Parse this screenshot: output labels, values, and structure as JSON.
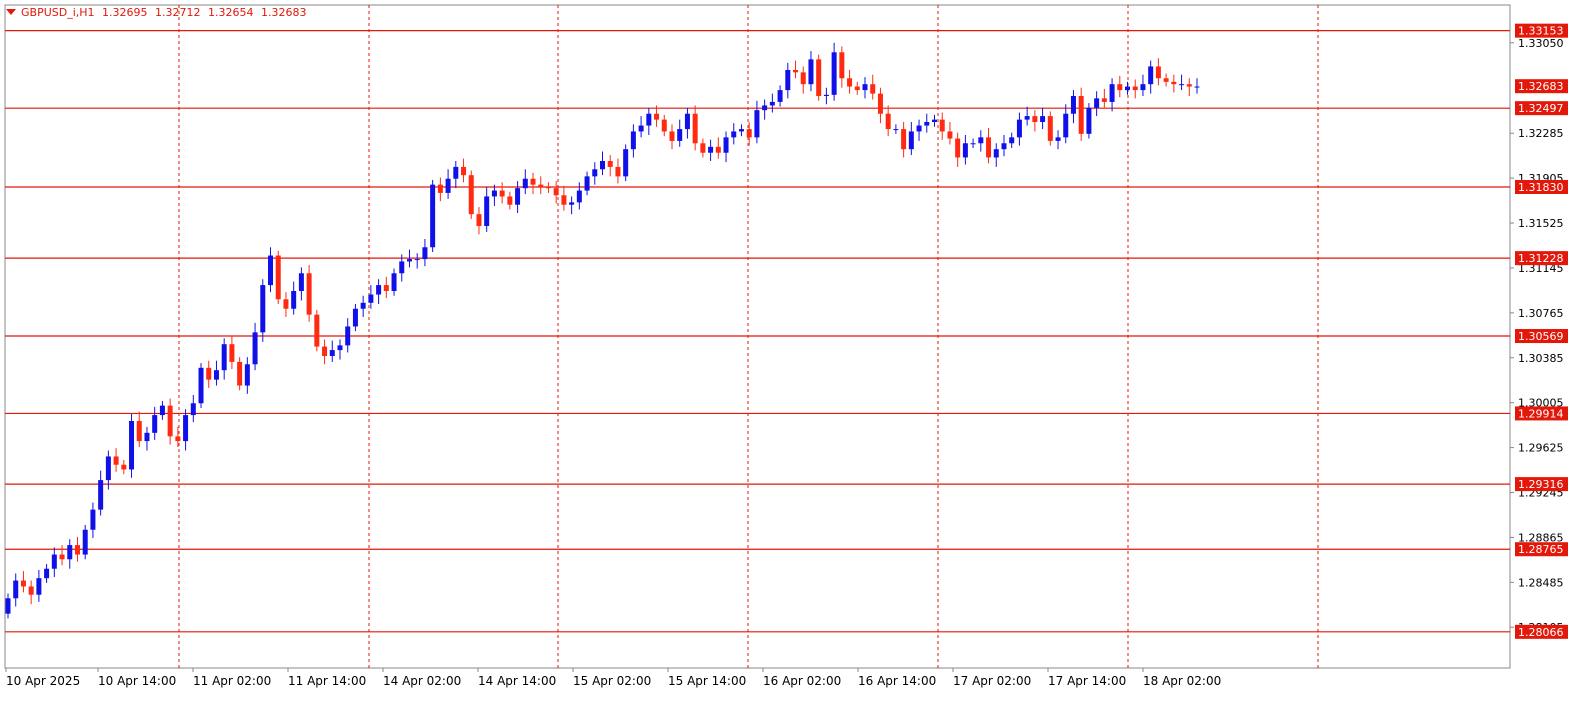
{
  "header": {
    "symbol": "GBPUSD_i,H1",
    "open": "1.32695",
    "high": "1.32712",
    "low": "1.32654",
    "close": "1.32683"
  },
  "colors": {
    "bull": "#1010e8",
    "bear": "#ff2a10",
    "level_line": "#e3170a",
    "label_bg": "#e3170a",
    "grid": "#e3170a",
    "axis_text": "#e3170a"
  },
  "chart_data": {
    "type": "candlestick",
    "symbol": "GBPUSD_i",
    "timeframe": "H1",
    "ylim": [
      1.2776,
      1.3337
    ],
    "y_ticks": [
      "1.33050",
      "1.32285",
      "1.31905",
      "1.31525",
      "1.31145",
      "1.30765",
      "1.30385",
      "1.30005",
      "1.29625",
      "1.29245",
      "1.28865",
      "1.28485",
      "1.28105"
    ],
    "x_labels": [
      "10 Apr 2025",
      "10 Apr 14:00",
      "11 Apr 02:00",
      "11 Apr 14:00",
      "14 Apr 02:00",
      "14 Apr 14:00",
      "15 Apr 02:00",
      "15 Apr 14:00",
      "16 Apr 02:00",
      "16 Apr 14:00",
      "17 Apr 02:00",
      "17 Apr 14:00",
      "18 Apr 02:00"
    ],
    "horizontal_levels": [
      "1.33153",
      "1.32497",
      "1.31830",
      "1.31228",
      "1.30569",
      "1.29914",
      "1.29316",
      "1.28765",
      "1.28066"
    ],
    "current_price": "1.32683",
    "grid": "vertical dashed",
    "closes": [
      1.2835,
      1.285,
      1.2845,
      1.2838,
      1.2852,
      1.286,
      1.2872,
      1.2868,
      1.288,
      1.2872,
      1.2893,
      1.291,
      1.2935,
      1.2955,
      1.2948,
      1.2944,
      1.2985,
      1.2968,
      1.2975,
      1.299,
      1.2998,
      1.2972,
      1.2968,
      1.299,
      1.3,
      1.303,
      1.302,
      1.3028,
      1.305,
      1.3035,
      1.3015,
      1.3033,
      1.306,
      1.31,
      1.3125,
      1.3088,
      1.308,
      1.3095,
      1.311,
      1.3075,
      1.3048,
      1.304,
      1.3045,
      1.3049,
      1.3065,
      1.308,
      1.3085,
      1.3092,
      1.31,
      1.3095,
      1.311,
      1.312,
      1.3122,
      1.3122,
      1.3132,
      1.3185,
      1.3178,
      1.319,
      1.32,
      1.3193,
      1.316,
      1.315,
      1.3175,
      1.318,
      1.3175,
      1.3168,
      1.3182,
      1.319,
      1.3185,
      1.3183,
      1.3182,
      1.3176,
      1.3168,
      1.317,
      1.318,
      1.3192,
      1.3198,
      1.3205,
      1.32,
      1.3192,
      1.3215,
      1.323,
      1.3235,
      1.3245,
      1.324,
      1.323,
      1.3222,
      1.3232,
      1.3245,
      1.322,
      1.3212,
      1.3217,
      1.3212,
      1.3225,
      1.323,
      1.3232,
      1.3225,
      1.3248,
      1.3252,
      1.3255,
      1.3265,
      1.3282,
      1.328,
      1.327,
      1.3291,
      1.326,
      1.3261,
      1.3297,
      1.3275,
      1.3268,
      1.3265,
      1.327,
      1.3262,
      1.3245,
      1.3232,
      1.3232,
      1.3215,
      1.323,
      1.3235,
      1.3238,
      1.324,
      1.323,
      1.3224,
      1.3208,
      1.322,
      1.322,
      1.3225,
      1.3208,
      1.3215,
      1.322,
      1.3225,
      1.324,
      1.3243,
      1.3238,
      1.3243,
      1.3222,
      1.3225,
      1.3245,
      1.326,
      1.3228,
      1.325,
      1.3258,
      1.3255,
      1.327,
      1.3265,
      1.3268,
      1.3265,
      1.327,
      1.3285,
      1.3275,
      1.3272,
      1.327,
      1.327,
      1.3268,
      1.3268
    ],
    "first_open": 1.2822
  }
}
